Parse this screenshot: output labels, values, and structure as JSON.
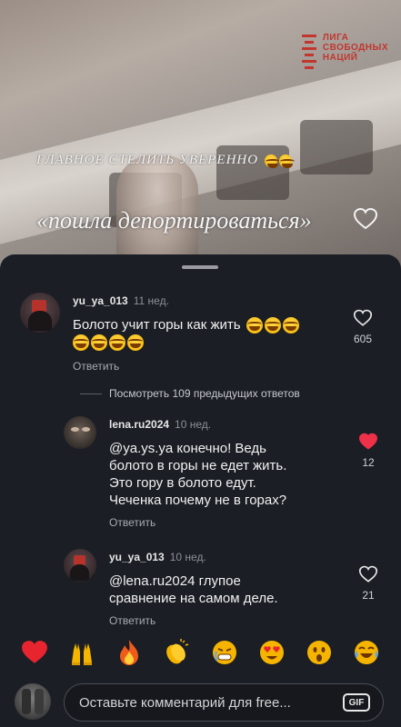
{
  "video": {
    "logo_lines": [
      "ЛИГА",
      "СВОБОДНЫХ",
      "НАЦИЙ"
    ],
    "caption_small": "ГЛАВНОЕ СТЕЛИТЬ УВЕРЕННО",
    "caption_large": "«пошла депортироваться»"
  },
  "comments": [
    {
      "username": "yu_ya_013",
      "time": "11 нед.",
      "text": "Болото учит горы как жить",
      "emoji_count": 7,
      "reply_label": "Ответить",
      "likes": "605",
      "liked": false
    },
    {
      "username": "lena.ru2024",
      "time": "10 нед.",
      "mention": "@ya.ys.ya",
      "text_lines": [
        "конечно! Ведь",
        "болото в горы не едет жить.",
        "Это гору в болото едут.",
        "Чеченка почему не в горах?"
      ],
      "reply_label": "Ответить",
      "likes": "12",
      "liked": true
    },
    {
      "username": "yu_ya_013",
      "time": "10 нед.",
      "mention": "@lena.ru2024",
      "text_lines": [
        "глупое",
        "сравнение на самом деле."
      ],
      "reply_label": "Ответить",
      "likes": "21",
      "liked": false
    }
  ],
  "view_more_label": "Посмотреть 109 предыдущих ответов",
  "reactions": [
    "heart",
    "raised-hands",
    "fire",
    "clapping-hands",
    "grimacing-face",
    "heart-eyes-face",
    "surprised-face",
    "tears-of-joy-face"
  ],
  "input": {
    "placeholder": "Оставьте комментарий для free...",
    "gif_label": "GIF"
  },
  "colors": {
    "sheet_bg": "#1b1e25",
    "liked_red": "#ee3148",
    "logo_red": "#c1372f"
  }
}
